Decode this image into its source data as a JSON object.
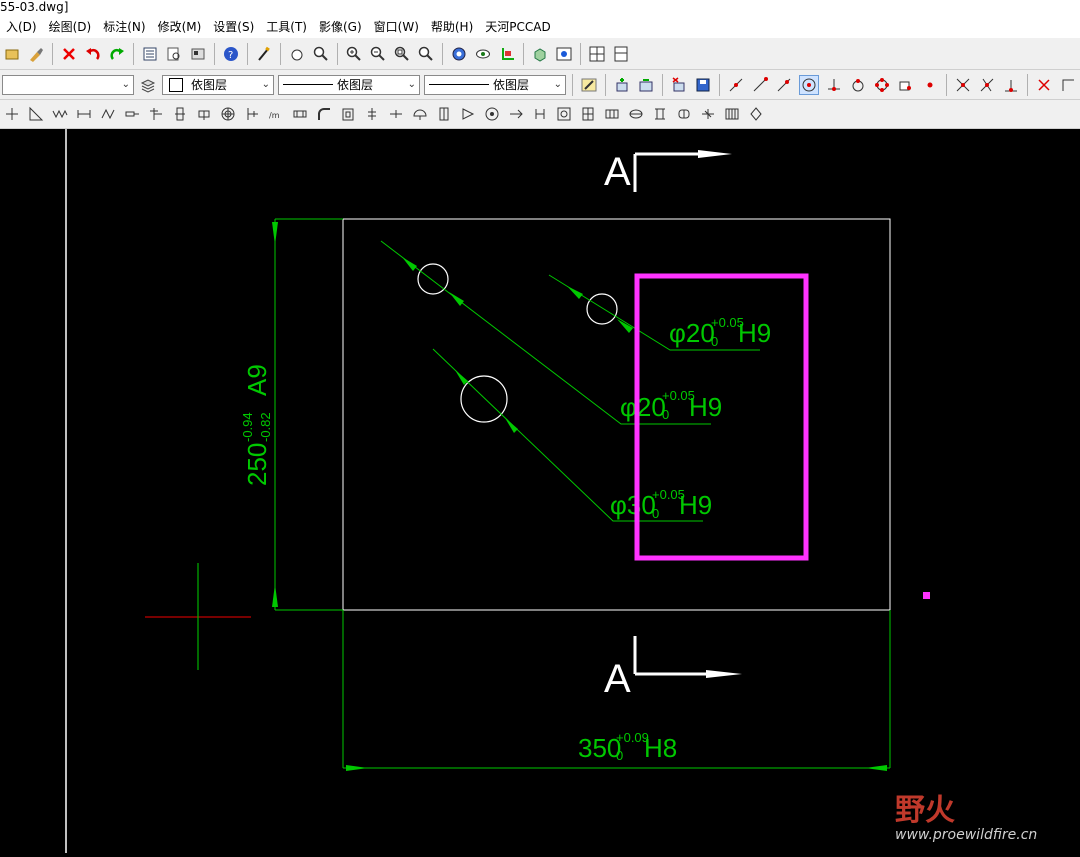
{
  "window": {
    "title": "55-03.dwg]"
  },
  "menu": [
    "入(D)",
    "绘图(D)",
    "标注(N)",
    "修改(M)",
    "设置(S)",
    "工具(T)",
    "影像(G)",
    "窗口(W)",
    "帮助(H)",
    "天河PCCAD"
  ],
  "toolbar2": {
    "layer_combo": "依图层",
    "linetype_combo": "依图层",
    "lineweight_combo": "依图层"
  },
  "drawing": {
    "section_label_top": "A",
    "section_label_bottom": "A",
    "callouts": [
      {
        "prefix": "φ20",
        "tol_upper": "+0.05",
        "tol_lower": "0",
        "fit": "H9"
      },
      {
        "prefix": "φ20",
        "tol_upper": "+0.05",
        "tol_lower": "0",
        "fit": "H9"
      },
      {
        "prefix": "φ30",
        "tol_upper": "+0.05",
        "tol_lower": "0",
        "fit": "H9"
      }
    ],
    "vertical_dim": {
      "value": "250",
      "tol_upper": "-0.94",
      "tol_lower": "-0.82",
      "fit": "A9"
    },
    "horizontal_dim": {
      "value": "350",
      "tol_upper": "+0.09",
      "tol_lower": "0",
      "fit": "H8"
    },
    "colors": {
      "dimension": "#00c800",
      "highlight": "#ff33ff",
      "geometry": "#ffffff",
      "crosshair_h": "#c00000",
      "crosshair_v": "#00b000"
    }
  },
  "watermark": {
    "brand": "野火",
    "url": "www.proewildfire.cn"
  }
}
